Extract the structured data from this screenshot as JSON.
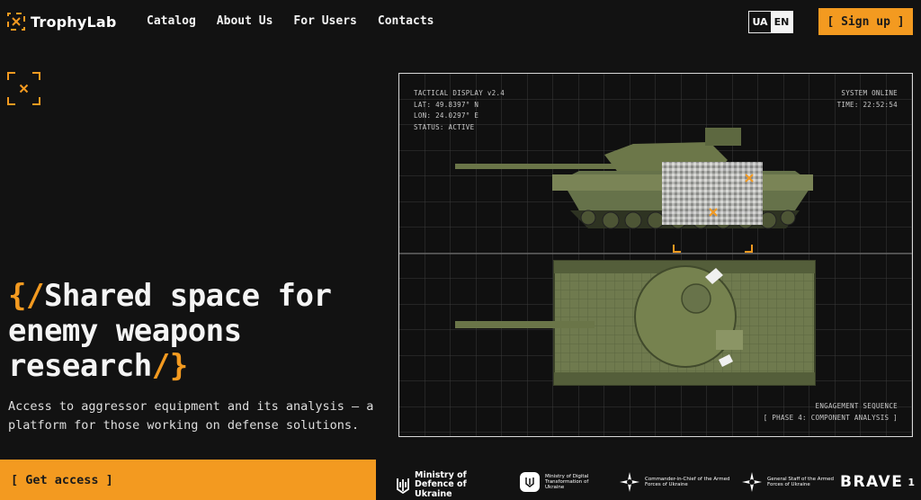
{
  "brand": {
    "name": "TrophyLab",
    "accent": "#f39a20",
    "background": "#121212"
  },
  "nav": {
    "items": [
      {
        "label": "Catalog"
      },
      {
        "label": "About Us"
      },
      {
        "label": "For Users"
      },
      {
        "label": "Contacts"
      }
    ],
    "lang": {
      "ua": "UA",
      "en": "EN",
      "active": "EN"
    },
    "signup_label": "[ Sign up ]"
  },
  "hero": {
    "title_prefix": "{/",
    "title_main": "Shared space for enemy weapons research",
    "title_suffix": "/}",
    "subtitle": "Access to aggressor equipment and its analysis — a platform for those working on defense solutions.",
    "cta_label": "[ Get access ]"
  },
  "tactical_display": {
    "title": "TACTICAL DISPLAY v2.4",
    "lat": "LAT: 49.8397° N",
    "lon": "LON: 24.0297° E",
    "status": "STATUS: ACTIVE",
    "system": "SYSTEM ONLINE",
    "time": "TIME: 22:52:54",
    "sequence": "ENGAGEMENT SEQUENCE",
    "phase": "[ PHASE 4: COMPONENT ANALYSIS ]"
  },
  "partners": {
    "mod": "Ministry of Defence of Ukraine",
    "mdt": "Ministry of Digital Transformation of Ukraine",
    "commander": "Commander-in-Chief of the Armed Forces of Ukraine",
    "general_staff": "General Staff of the Armed Forces of Ukraine",
    "brave": "BRAVE",
    "brave_sup": "1"
  },
  "icons": [
    "logo-mark-icon",
    "target-corner-icon",
    "trident-icon",
    "crest-icon",
    "cross-emblem-icon"
  ]
}
